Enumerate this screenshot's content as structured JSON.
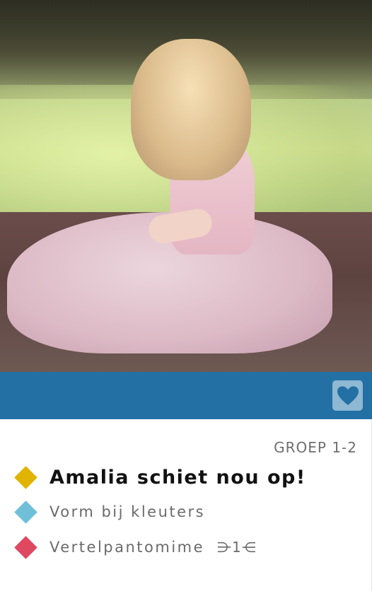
{
  "card": {
    "image": {
      "icon": "photo-girl-in-pink-dress"
    },
    "favorite": {
      "icon": "heart-icon"
    },
    "group_label": "GROEP 1-2",
    "title": "Amalia schiet nou op!",
    "categories": [
      {
        "label": "Vorm bij kleuters",
        "color": "#6fbfd9"
      },
      {
        "label": "Vertelpantomime",
        "color": "#e04760",
        "extra": "⋺1⋲"
      }
    ],
    "title_color": "#e0b400",
    "band_color": "#2270a4"
  }
}
